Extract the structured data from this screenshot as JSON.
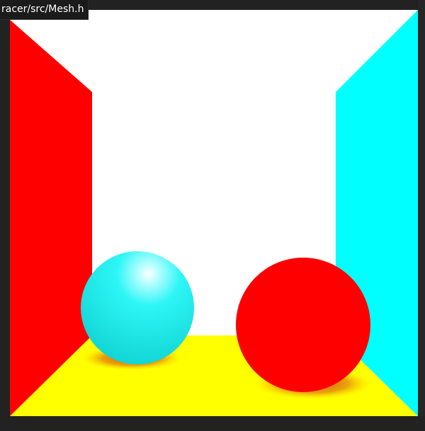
{
  "tooltip": {
    "text": "racer/src/Mesh.h"
  },
  "render": {
    "colors": {
      "background_wall": "#ffffff",
      "left_wall": "#ff0000",
      "right_wall": "#00ffff",
      "floor": "#ffff00",
      "cyan_sphere": "#2ef6f6",
      "red_sphere": "#ff0000",
      "shadow": "#e07a10"
    }
  }
}
